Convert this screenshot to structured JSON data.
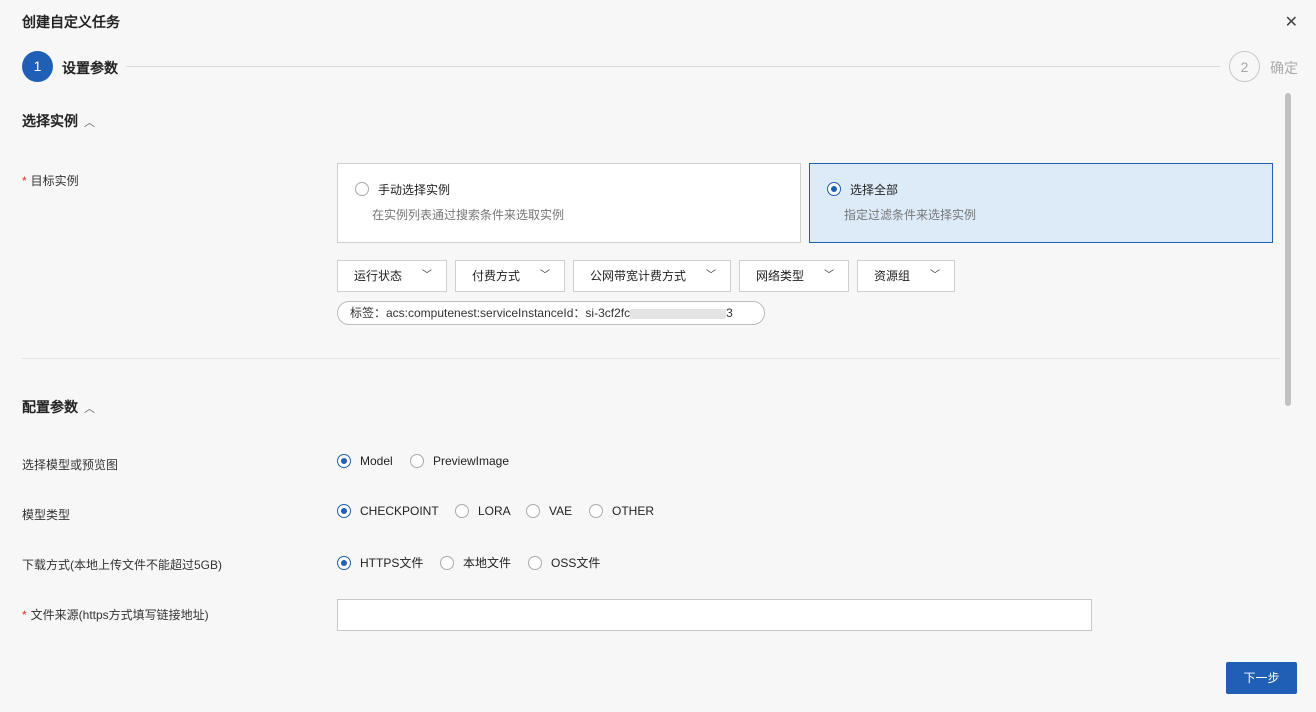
{
  "dialog": {
    "title": "创建自定义任务",
    "close_icon": "close-icon"
  },
  "steps": [
    {
      "number": "1",
      "label": "设置参数",
      "active": true
    },
    {
      "number": "2",
      "label": "确定",
      "active": false
    }
  ],
  "section_instances": {
    "title": "选择实例",
    "target_label": "目标实例",
    "cards": [
      {
        "title": "手动选择实例",
        "desc": "在实例列表通过搜索条件来选取实例",
        "selected": false
      },
      {
        "title": "选择全部",
        "desc": "指定过滤条件来选择实例",
        "selected": true
      }
    ],
    "filters": [
      "运行状态",
      "付费方式",
      "公网带宽计费方式",
      "网络类型",
      "资源组"
    ],
    "tag": {
      "prefix": "标签：acs:computenest:serviceInstanceId：si-3cf2fc",
      "suffix": "3"
    }
  },
  "section_params": {
    "title": "配置参数",
    "rows": [
      {
        "label": "选择模型或预览图",
        "options": [
          "Model",
          "PreviewImage"
        ],
        "selected": 0
      },
      {
        "label": "模型类型",
        "options": [
          "CHECKPOINT",
          "LORA",
          "VAE",
          "OTHER"
        ],
        "selected": 0
      },
      {
        "label": "下载方式(本地上传文件不能超过5GB)",
        "options": [
          "HTTPS文件",
          "本地文件",
          "OSS文件"
        ],
        "selected": 0
      }
    ],
    "source_label": "文件来源(https方式填写链接地址)",
    "source_value": ""
  },
  "footer": {
    "next_label": "下一步"
  },
  "colors": {
    "primary": "#1f5fb5",
    "required": "#d93026",
    "selected_card_bg": "#ddeaf8"
  }
}
